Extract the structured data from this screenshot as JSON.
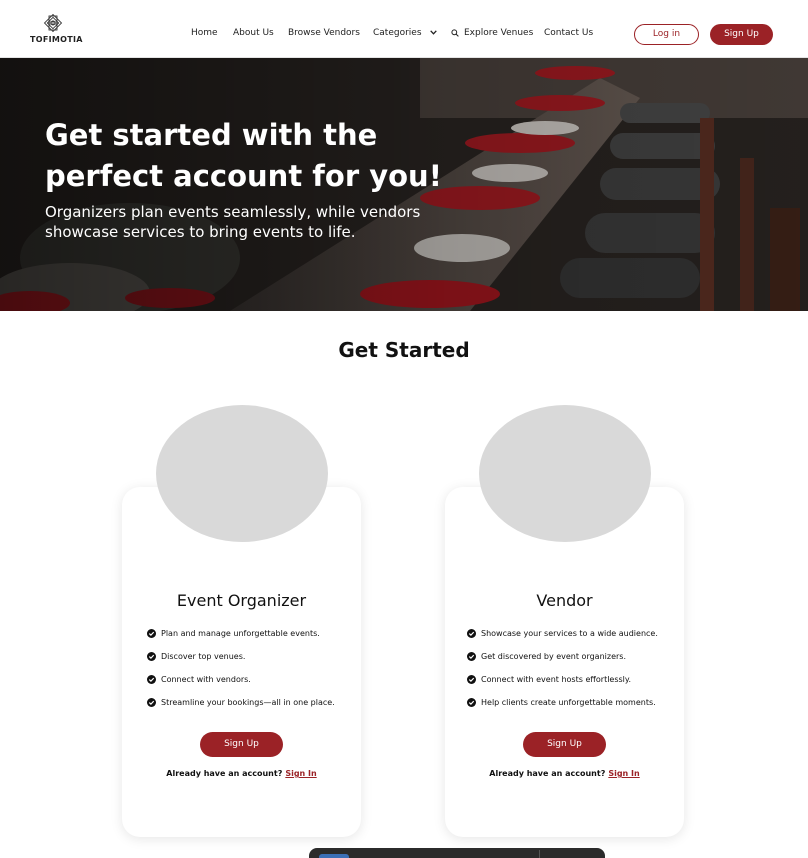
{
  "brand": {
    "name": "TOFIMOTIA"
  },
  "nav": {
    "items": [
      {
        "label": "Home"
      },
      {
        "label": "About Us"
      },
      {
        "label": "Browse Vendors"
      },
      {
        "label": "Categories"
      },
      {
        "label": "Explore Venues"
      },
      {
        "label": "Contact Us"
      }
    ],
    "login_label": "Log in",
    "signup_label": "Sign Up"
  },
  "hero": {
    "title": "Get started with the perfect account for you!",
    "subtitle": "Organizers plan events seamlessly, while vendors showcase services to bring events to life."
  },
  "get_started": {
    "title": "Get Started",
    "cards": [
      {
        "title": "Event Organizer",
        "features": [
          "Plan and manage unforgettable events.",
          "Discover top venues.",
          "Connect with vendors.",
          "Streamline your bookings—all in one place."
        ],
        "button_label": "Sign Up",
        "signin_prompt": "Already have an account?",
        "signin_link": "Sign In"
      },
      {
        "title": "Vendor",
        "features": [
          "Showcase your services to a wide audience.",
          "Get discovered by event organizers.",
          "Connect with event hosts effortlessly.",
          "Help clients create unforgettable moments."
        ],
        "button_label": "Sign Up",
        "signin_prompt": "Already have an account?",
        "signin_link": "Sign In"
      }
    ]
  },
  "colors": {
    "accent": "#9b2226",
    "avatar_placeholder": "#d9d9d9",
    "text": "#111111"
  },
  "icons": [
    "logo-diamond-icon",
    "chevron-down-icon",
    "search-icon",
    "check-circle-icon"
  ]
}
